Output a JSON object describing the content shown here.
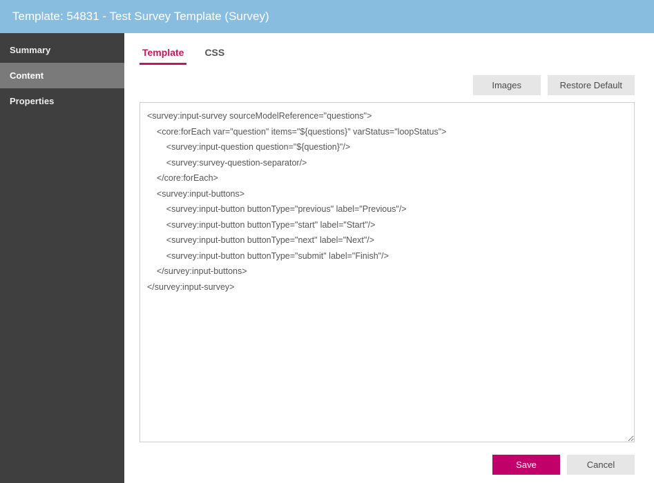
{
  "header": {
    "title": "Template: 54831 - Test Survey Template (Survey)"
  },
  "sidebar": {
    "items": [
      {
        "label": "Summary",
        "active": false
      },
      {
        "label": "Content",
        "active": true
      },
      {
        "label": "Properties",
        "active": false
      }
    ]
  },
  "tabs": [
    {
      "label": "Template",
      "active": true
    },
    {
      "label": "CSS",
      "active": false
    }
  ],
  "actions": {
    "images": "Images",
    "restore_default": "Restore Default"
  },
  "editor": {
    "value": "<survey:input-survey sourceModelReference=\"questions\">\n    <core:forEach var=\"question\" items=\"${questions}\" varStatus=\"loopStatus\">\n        <survey:input-question question=\"${question}\"/>\n        <survey:survey-question-separator/>\n    </core:forEach>\n    <survey:input-buttons>\n        <survey:input-button buttonType=\"previous\" label=\"Previous\"/>\n        <survey:input-button buttonType=\"start\" label=\"Start\"/>\n        <survey:input-button buttonType=\"next\" label=\"Next\"/>\n        <survey:input-button buttonType=\"submit\" label=\"Finish\"/>\n    </survey:input-buttons>\n</survey:input-survey>"
  },
  "footer": {
    "save": "Save",
    "cancel": "Cancel"
  }
}
